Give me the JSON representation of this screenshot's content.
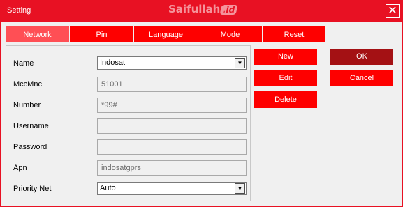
{
  "window": {
    "title": "Setting",
    "watermark": "Saifullah",
    "watermark_suffix": ".id",
    "close_glyph": "✕"
  },
  "tabs": [
    {
      "label": "Network",
      "active": true
    },
    {
      "label": "Pin"
    },
    {
      "label": "Language"
    },
    {
      "label": "Mode"
    },
    {
      "label": "Reset"
    }
  ],
  "form": {
    "name_label": "Name",
    "name_value": "Indosat",
    "mccmnc_label": "MccMnc",
    "mccmnc_value": "51001",
    "number_label": "Number",
    "number_value": "*99#",
    "username_label": "Username",
    "username_value": "",
    "password_label": "Password",
    "password_value": "",
    "apn_label": "Apn",
    "apn_value": "indosatgprs",
    "priority_label": "Priority Net",
    "priority_value": "Auto",
    "arrow_glyph": "▼"
  },
  "actions": {
    "new_label": "New",
    "edit_label": "Edit",
    "delete_label": "Delete",
    "ok_label": "OK",
    "cancel_label": "Cancel"
  },
  "colors": {
    "accent": "#fe0000",
    "titlebar": "#e81123",
    "tab_active": "#ff4f55",
    "ok_button": "#a41114"
  }
}
